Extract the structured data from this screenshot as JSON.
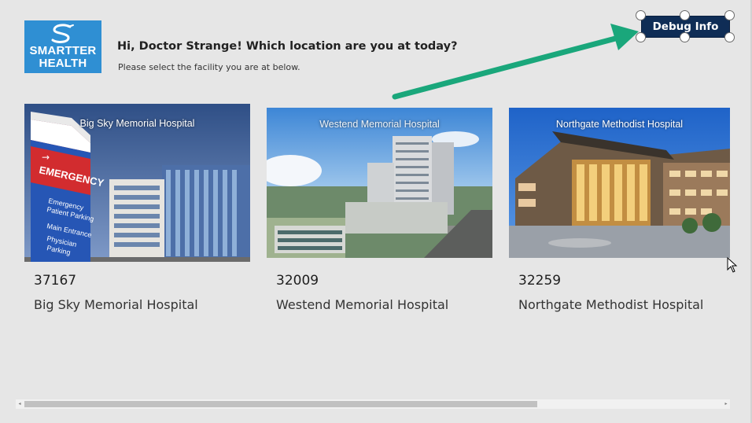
{
  "header": {
    "logo_line1": "SMARTTER",
    "logo_line2": "HEALTH",
    "greeting": "Hi, Doctor Strange! Which location are you at today?",
    "subtext": "Please select the facility you are at below."
  },
  "debug_button": {
    "label": "Debug Info"
  },
  "colors": {
    "logo_bg": "#2f8fd3",
    "debug_bg": "#0f2d56",
    "arrow": "#1aa77b"
  },
  "facilities": [
    {
      "code": "37167",
      "name": "Big Sky Memorial Hospital",
      "caption": "Big Sky Memorial Hospital"
    },
    {
      "code": "32009",
      "name": "Westend Memorial Hospital",
      "caption": "Westend Memorial Hospital"
    },
    {
      "code": "32259",
      "name": "Northgate Methodist Hospital",
      "caption": "Northgate Methodist Hospital"
    }
  ],
  "sign": {
    "emergency": "EMERGENCY",
    "line1": "Emergency",
    "line2": "Patient Parking",
    "line3": "Main Entrance",
    "line4": "Physician",
    "line5": "Parking"
  },
  "icons": {
    "cursor": "mouse-pointer-icon",
    "scroll_left": "scroll-left-arrow-icon",
    "scroll_right": "scroll-right-arrow-icon",
    "logo": "smartter-health-logo-icon"
  }
}
